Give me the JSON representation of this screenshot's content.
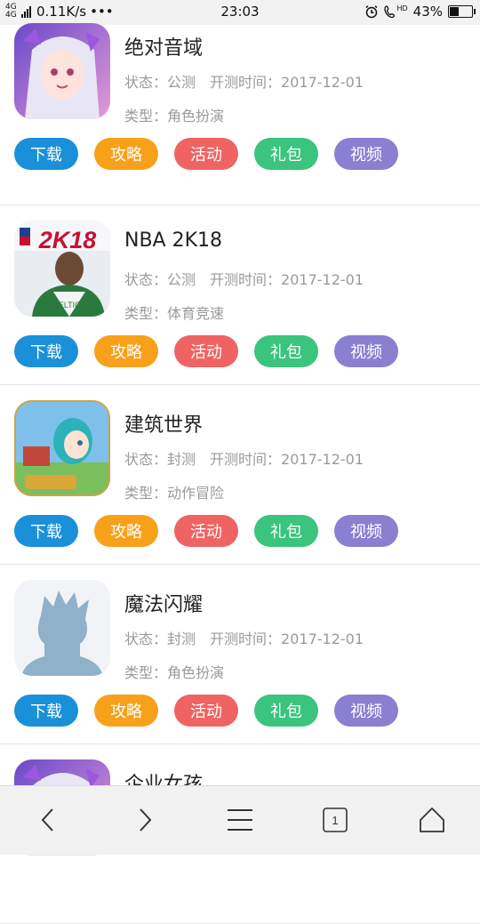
{
  "status_bar": {
    "network": "4G 4G",
    "speed": "0.11K/s",
    "dots": "•••",
    "time": "23:03",
    "hd": "HD",
    "battery_pct": "43%",
    "battery_level": 0.43
  },
  "labels": {
    "status_prefix": "状态：",
    "date_prefix": "开测时间：",
    "type_prefix": "类型："
  },
  "buttons": [
    {
      "label": "下载",
      "color": "#1a90d9"
    },
    {
      "label": "攻略",
      "color": "#f7a11a"
    },
    {
      "label": "活动",
      "color": "#ef6463"
    },
    {
      "label": "礼包",
      "color": "#3ac47d"
    },
    {
      "label": "视频",
      "color": "#8a7fd0"
    }
  ],
  "games": [
    {
      "name": "绝对音域",
      "status": "公测",
      "date": "2017-12-01",
      "type": "角色扮演",
      "icon": "anime-girl-icon"
    },
    {
      "name": "NBA 2K18",
      "status": "公测",
      "date": "2017-12-01",
      "type": "体育竞速",
      "icon": "nba-2k18-icon",
      "icon_text": "2K18"
    },
    {
      "name": "建筑世界",
      "status": "封测",
      "date": "2017-12-01",
      "type": "动作冒险",
      "icon": "anime-builder-icon"
    },
    {
      "name": "魔法闪耀",
      "status": "封测",
      "date": "2017-12-01",
      "type": "角色扮演",
      "icon": "avatar-placeholder-icon"
    },
    {
      "name": "企业女孩",
      "icon": "anime-girl-icon"
    }
  ]
}
